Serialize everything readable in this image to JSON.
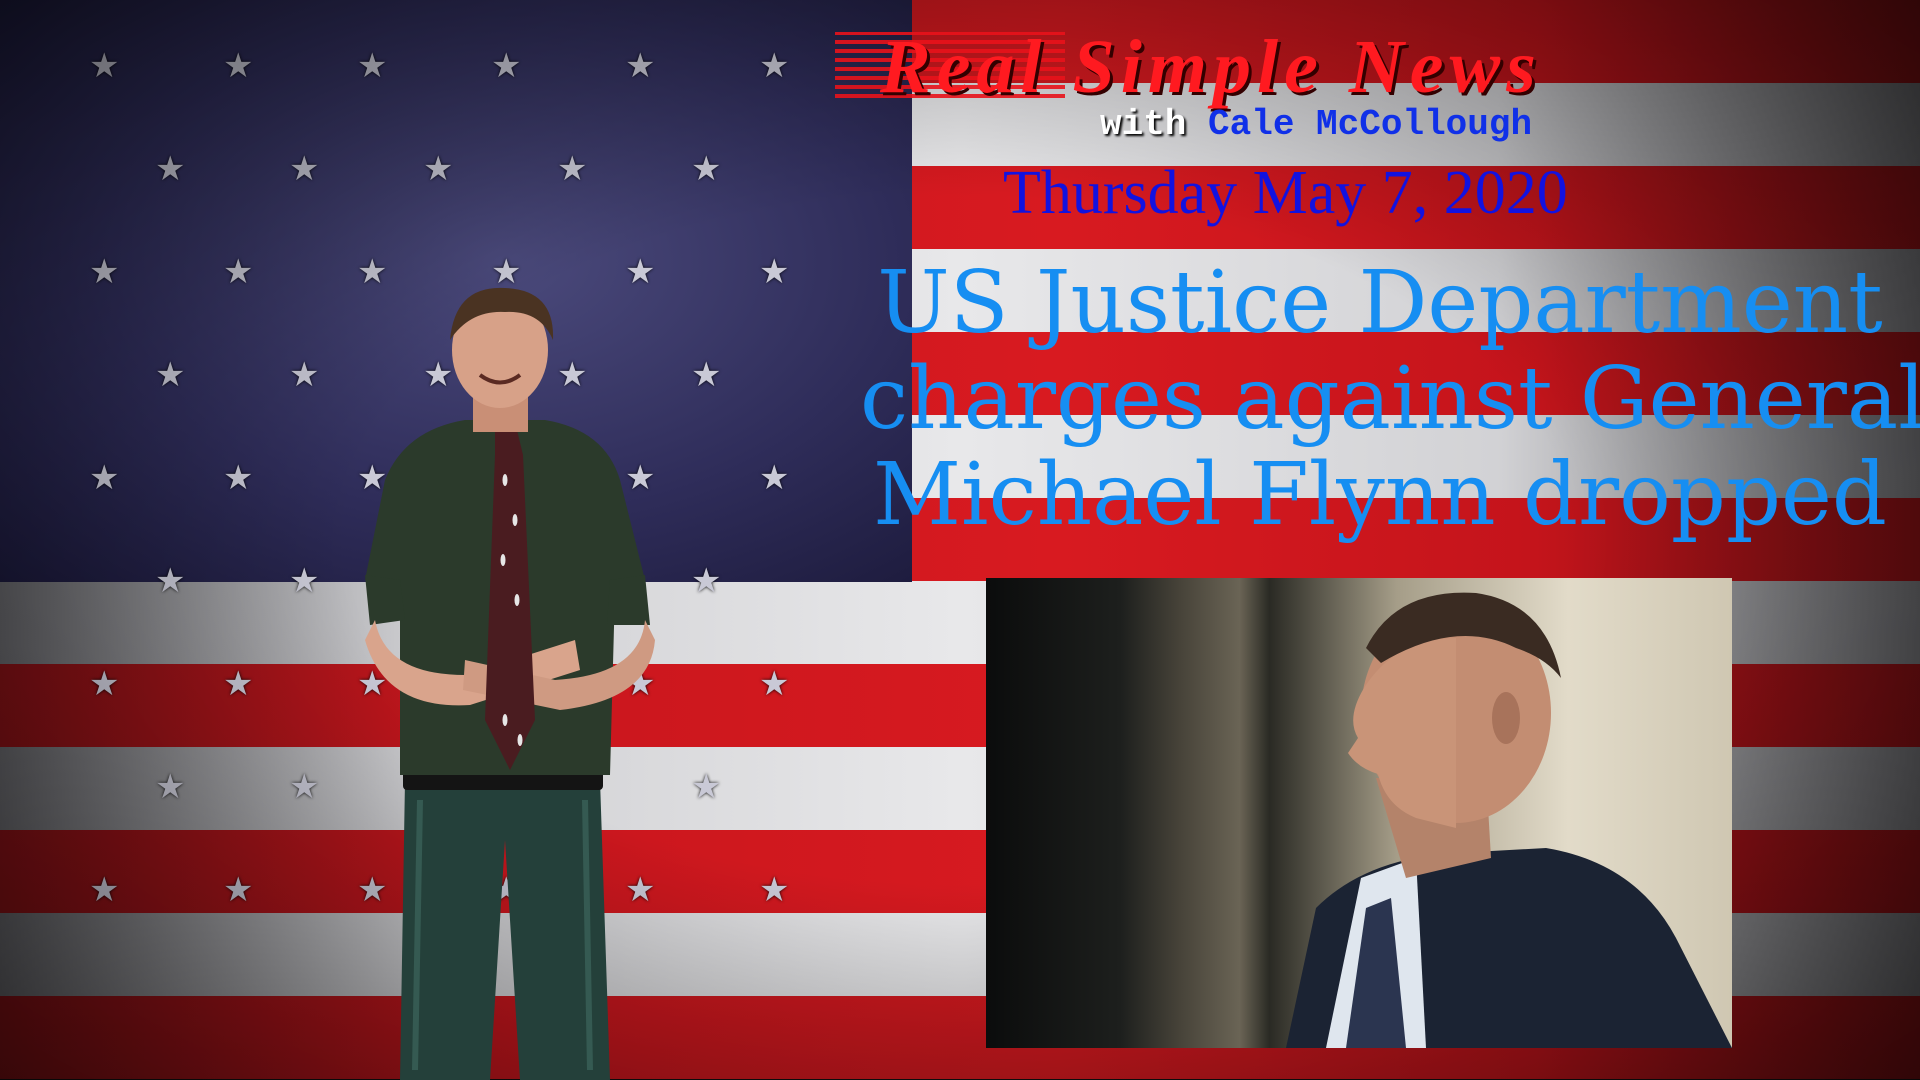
{
  "brand": {
    "title": "Real Simple News"
  },
  "host": {
    "prefix": "with",
    "name": "Cale McCollough"
  },
  "date": "Thursday May 7, 2020",
  "headline": {
    "lines": [
      "US Justice Department",
      "charges against General",
      "Michael Flynn dropped"
    ]
  },
  "colors": {
    "brand_red": "#ff1a20",
    "host_name_blue": "#1030e8",
    "date_blue": "#1212e0",
    "headline_blue": "#168ef2"
  }
}
